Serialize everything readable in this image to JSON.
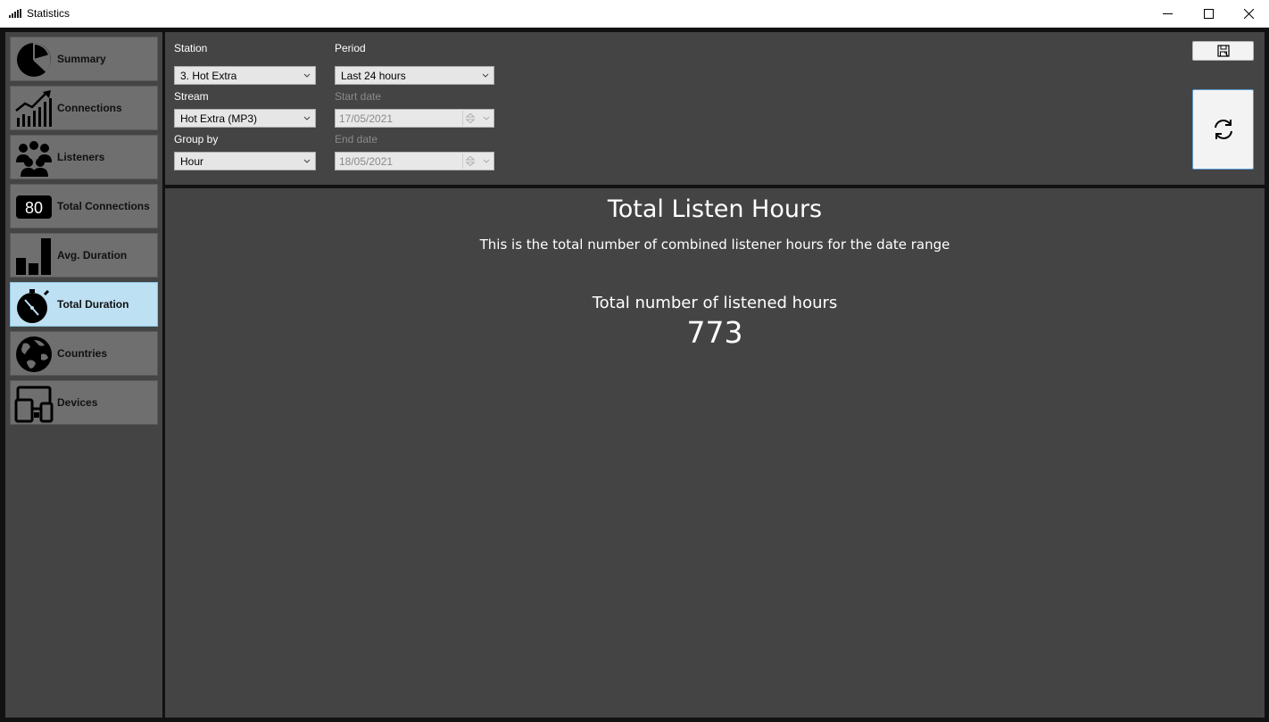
{
  "window": {
    "title": "Statistics",
    "icon": "signal-bars-icon"
  },
  "sidebar": {
    "items": [
      {
        "label": "Summary",
        "icon": "pie-chart-icon",
        "active": false
      },
      {
        "label": "Connections",
        "icon": "trending-chart-icon",
        "active": false
      },
      {
        "label": "Listeners",
        "icon": "people-group-icon",
        "active": false
      },
      {
        "label": "Total Connections",
        "icon": "counter-80-icon",
        "badge": "80",
        "active": false
      },
      {
        "label": "Avg. Duration",
        "icon": "bar-chart-icon",
        "active": false
      },
      {
        "label": "Total Duration",
        "icon": "stopwatch-icon",
        "active": true
      },
      {
        "label": "Countries",
        "icon": "globe-icon",
        "active": false
      },
      {
        "label": "Devices",
        "icon": "devices-icon",
        "active": false
      }
    ]
  },
  "controls": {
    "station": {
      "label": "Station",
      "value": "3. Hot Extra"
    },
    "stream": {
      "label": "Stream",
      "value": "Hot Extra (MP3)"
    },
    "group_by": {
      "label": "Group by",
      "value": "Hour"
    },
    "period": {
      "label": "Period",
      "value": "Last 24 hours"
    },
    "start_date": {
      "label": "Start date",
      "value": "17/05/2021"
    },
    "end_date": {
      "label": "End date",
      "value": "18/05/2021"
    },
    "save_icon": "save-icon",
    "refresh_icon": "refresh-icon"
  },
  "main": {
    "title": "Total Listen Hours",
    "subtitle": "This is the total number of combined listener hours for the date range",
    "metric_label": "Total number of listened hours",
    "metric_value": "773"
  },
  "colors": {
    "panel": "#444444",
    "nav_item": "#6f6f6f",
    "nav_active": "#bde0f2",
    "frame": "#111111"
  }
}
